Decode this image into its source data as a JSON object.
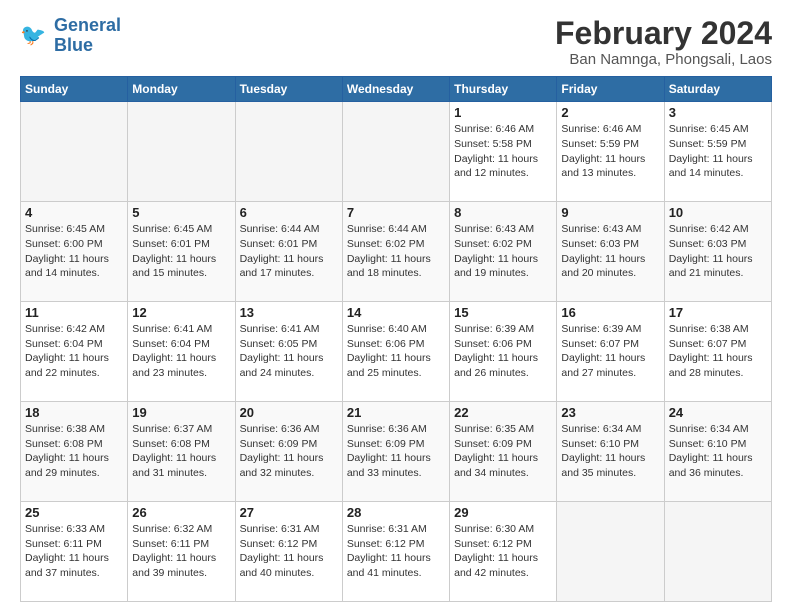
{
  "logo": {
    "line1": "General",
    "line2": "Blue"
  },
  "title": "February 2024",
  "subtitle": "Ban Namnga, Phongsali, Laos",
  "days_of_week": [
    "Sunday",
    "Monday",
    "Tuesday",
    "Wednesday",
    "Thursday",
    "Friday",
    "Saturday"
  ],
  "weeks": [
    [
      {
        "day": "",
        "info": ""
      },
      {
        "day": "",
        "info": ""
      },
      {
        "day": "",
        "info": ""
      },
      {
        "day": "",
        "info": ""
      },
      {
        "day": "1",
        "info": "Sunrise: 6:46 AM\nSunset: 5:58 PM\nDaylight: 11 hours and 12 minutes."
      },
      {
        "day": "2",
        "info": "Sunrise: 6:46 AM\nSunset: 5:59 PM\nDaylight: 11 hours and 13 minutes."
      },
      {
        "day": "3",
        "info": "Sunrise: 6:45 AM\nSunset: 5:59 PM\nDaylight: 11 hours and 14 minutes."
      }
    ],
    [
      {
        "day": "4",
        "info": "Sunrise: 6:45 AM\nSunset: 6:00 PM\nDaylight: 11 hours and 14 minutes."
      },
      {
        "day": "5",
        "info": "Sunrise: 6:45 AM\nSunset: 6:01 PM\nDaylight: 11 hours and 15 minutes."
      },
      {
        "day": "6",
        "info": "Sunrise: 6:44 AM\nSunset: 6:01 PM\nDaylight: 11 hours and 17 minutes."
      },
      {
        "day": "7",
        "info": "Sunrise: 6:44 AM\nSunset: 6:02 PM\nDaylight: 11 hours and 18 minutes."
      },
      {
        "day": "8",
        "info": "Sunrise: 6:43 AM\nSunset: 6:02 PM\nDaylight: 11 hours and 19 minutes."
      },
      {
        "day": "9",
        "info": "Sunrise: 6:43 AM\nSunset: 6:03 PM\nDaylight: 11 hours and 20 minutes."
      },
      {
        "day": "10",
        "info": "Sunrise: 6:42 AM\nSunset: 6:03 PM\nDaylight: 11 hours and 21 minutes."
      }
    ],
    [
      {
        "day": "11",
        "info": "Sunrise: 6:42 AM\nSunset: 6:04 PM\nDaylight: 11 hours and 22 minutes."
      },
      {
        "day": "12",
        "info": "Sunrise: 6:41 AM\nSunset: 6:04 PM\nDaylight: 11 hours and 23 minutes."
      },
      {
        "day": "13",
        "info": "Sunrise: 6:41 AM\nSunset: 6:05 PM\nDaylight: 11 hours and 24 minutes."
      },
      {
        "day": "14",
        "info": "Sunrise: 6:40 AM\nSunset: 6:06 PM\nDaylight: 11 hours and 25 minutes."
      },
      {
        "day": "15",
        "info": "Sunrise: 6:39 AM\nSunset: 6:06 PM\nDaylight: 11 hours and 26 minutes."
      },
      {
        "day": "16",
        "info": "Sunrise: 6:39 AM\nSunset: 6:07 PM\nDaylight: 11 hours and 27 minutes."
      },
      {
        "day": "17",
        "info": "Sunrise: 6:38 AM\nSunset: 6:07 PM\nDaylight: 11 hours and 28 minutes."
      }
    ],
    [
      {
        "day": "18",
        "info": "Sunrise: 6:38 AM\nSunset: 6:08 PM\nDaylight: 11 hours and 29 minutes."
      },
      {
        "day": "19",
        "info": "Sunrise: 6:37 AM\nSunset: 6:08 PM\nDaylight: 11 hours and 31 minutes."
      },
      {
        "day": "20",
        "info": "Sunrise: 6:36 AM\nSunset: 6:09 PM\nDaylight: 11 hours and 32 minutes."
      },
      {
        "day": "21",
        "info": "Sunrise: 6:36 AM\nSunset: 6:09 PM\nDaylight: 11 hours and 33 minutes."
      },
      {
        "day": "22",
        "info": "Sunrise: 6:35 AM\nSunset: 6:09 PM\nDaylight: 11 hours and 34 minutes."
      },
      {
        "day": "23",
        "info": "Sunrise: 6:34 AM\nSunset: 6:10 PM\nDaylight: 11 hours and 35 minutes."
      },
      {
        "day": "24",
        "info": "Sunrise: 6:34 AM\nSunset: 6:10 PM\nDaylight: 11 hours and 36 minutes."
      }
    ],
    [
      {
        "day": "25",
        "info": "Sunrise: 6:33 AM\nSunset: 6:11 PM\nDaylight: 11 hours and 37 minutes."
      },
      {
        "day": "26",
        "info": "Sunrise: 6:32 AM\nSunset: 6:11 PM\nDaylight: 11 hours and 39 minutes."
      },
      {
        "day": "27",
        "info": "Sunrise: 6:31 AM\nSunset: 6:12 PM\nDaylight: 11 hours and 40 minutes."
      },
      {
        "day": "28",
        "info": "Sunrise: 6:31 AM\nSunset: 6:12 PM\nDaylight: 11 hours and 41 minutes."
      },
      {
        "day": "29",
        "info": "Sunrise: 6:30 AM\nSunset: 6:12 PM\nDaylight: 11 hours and 42 minutes."
      },
      {
        "day": "",
        "info": ""
      },
      {
        "day": "",
        "info": ""
      }
    ]
  ]
}
